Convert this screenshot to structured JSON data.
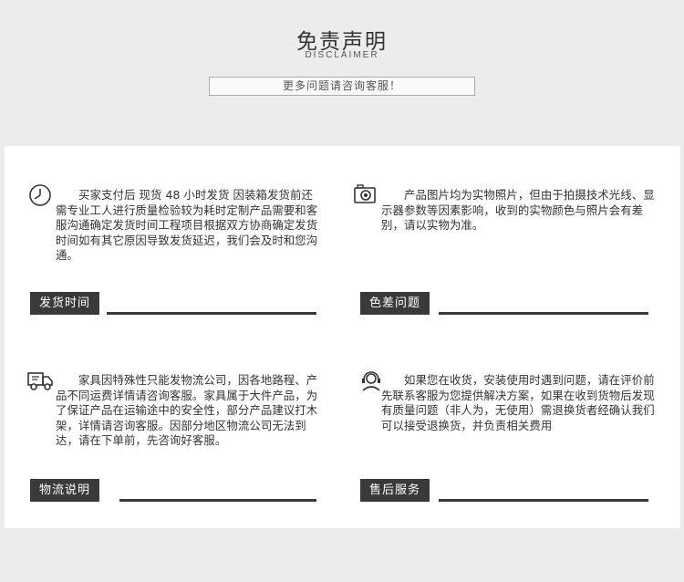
{
  "header": {
    "title": "免责声明",
    "subtitle": "DISCLAIMER",
    "more_text": "更多问题请咨询客服！"
  },
  "blocks": [
    {
      "icon": "clock-icon",
      "text": "　　买家支付后 现货 48 小时发货 因装箱发货前还需专业工人进行质量检验较为耗时定制产品需要和客服沟通确定发货时间工程项目根据双方协商确定发货时间如有其它原因导致发货延迟，我们会及时和您沟通。",
      "label": "发货时间"
    },
    {
      "icon": "camera-icon",
      "text": "　　产品图片均为实物照片，但由于拍摄技术光线、显示器参数等因素影响，收到的实物颜色与照片会有差别，请以实物为准。",
      "label": "色差问题"
    },
    {
      "icon": "truck-icon",
      "text": "　　家具因特殊性只能发物流公司，因各地路程、产品不同运费详情请咨询客服。家具属于大件产品，为了保证产品在运输途中的安全性，部分产品建议打木架，详情请咨询客服。因部分地区物流公司无法到达，请在下单前，先咨询好客服。",
      "label": "物流说明"
    },
    {
      "icon": "headset-icon",
      "text": "　　如果您在收货，安装使用时遇到问题，请在评价前先联系客服为您提供解决方案，如果在收到货物后发现有质量问题（非人为，无使用）需退换货者经确认我们可以接受退换货，并负责相关费用",
      "label": "售后服务"
    }
  ]
}
